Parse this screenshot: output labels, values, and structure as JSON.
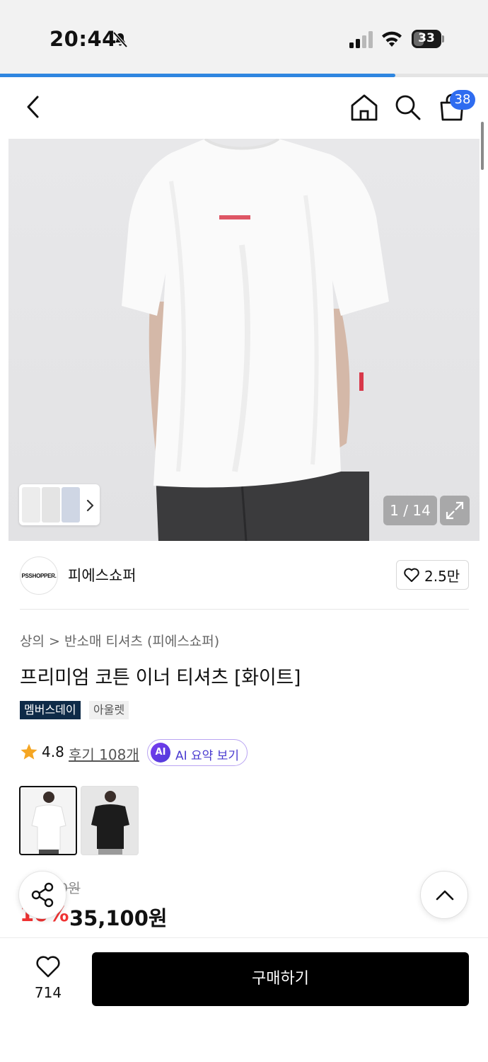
{
  "status_bar": {
    "time": "20:44",
    "battery": "33"
  },
  "page_progress": 0.81,
  "header": {
    "cart_count": "38"
  },
  "gallery": {
    "counter": "1 / 14"
  },
  "brand": {
    "logo_text": "PSSHOPPER.",
    "name": "피에스쇼퍼",
    "like_count": "2.5만"
  },
  "breadcrumb": {
    "level1": "상의",
    "separator": ">",
    "level2": "반소매 티셔츠 (피에스쇼퍼)"
  },
  "product": {
    "title": "프리미엄 코튼 이너 티셔츠 [화이트]",
    "badges": [
      "멤버스데이",
      "아울렛"
    ],
    "rating": "4.8",
    "review_link": "후기 108개",
    "ai_badge": "AI",
    "ai_summary": "AI 요약 보기",
    "original_price": "0원",
    "discount": "10%",
    "price": "35,100원"
  },
  "bottom_bar": {
    "wish_count": "714",
    "buy_label": "구매하기"
  },
  "colors": {
    "accent_blue": "#2f6cf0",
    "buy_button": "#000000",
    "discount_red": "#f03333",
    "member_badge": "#0e2a47",
    "star": "#f5a623"
  },
  "icons": [
    "mute-icon",
    "signal-icon",
    "wifi-icon",
    "battery-icon",
    "back-icon",
    "home-icon",
    "search-icon",
    "cart-icon",
    "expand-icon",
    "heart-icon",
    "star-icon",
    "share-icon",
    "chevron-up-icon"
  ]
}
